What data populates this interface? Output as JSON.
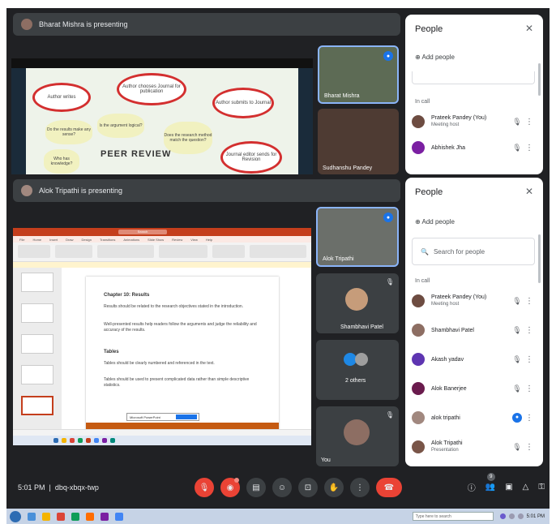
{
  "top_window": {
    "presenting_text": "Bharat Mishra is presenting",
    "slide": {
      "title": "PEER REVIEW",
      "ellipses": [
        "Author writes",
        "Author chooses Journal for publication",
        "Author submits to Journal",
        "Journal editor sends for Revision"
      ],
      "clouds": [
        "Do the results make any sense?",
        "Is the argument logical?",
        "Does the research method match the question?",
        "Who has knowledge?"
      ]
    },
    "tiles": [
      {
        "name": "Bharat Mishra"
      },
      {
        "name": "Sudhanshu Pandey"
      }
    ],
    "people_panel": {
      "title": "People",
      "close_icon": "close-icon",
      "add_people": "Add people",
      "in_call": "In call",
      "members": [
        {
          "name": "Prateek Pandey (You)",
          "sub": "Meeting host",
          "avatar_color": "#6d4c41"
        },
        {
          "name": "Abhishek Jha",
          "sub": "",
          "avatar_color": "#7b1fa2"
        }
      ]
    }
  },
  "bottom_window": {
    "presenting_text": "Alok Tripathi is presenting",
    "tiles": [
      {
        "name": "Alok Tripathi"
      },
      {
        "name": "Shambhavi Patel"
      },
      {
        "name": "2 others"
      },
      {
        "name": "You"
      }
    ],
    "ppt": {
      "search_placeholder": "Search",
      "ribbon_tabs": [
        "File",
        "Home",
        "Insert",
        "Draw",
        "Design",
        "Transitions",
        "Animations",
        "Slide Show",
        "Review",
        "View",
        "Help"
      ],
      "slide_heading_1": "Chapter 10: Results",
      "slide_bullets_1": [
        "Results should be related to the research objectives stated in the introduction.",
        "Well-presented results help readers follow the arguments and judge the reliability and accuracy of the results."
      ],
      "slide_heading_2": "Tables",
      "slide_bullets_2": [
        "Tables should be clearly numbered and referenced in the text.",
        "Tables should be used to present complicated data rather than simple descriptive statistics."
      ],
      "dialog_text": "Microsoft PowerPoint"
    },
    "people_panel": {
      "title": "People",
      "add_people": "Add people",
      "search_placeholder": "Search for people",
      "in_call": "In call",
      "members": [
        {
          "name": "Prateek Pandey (You)",
          "sub": "Meeting host",
          "avatar_color": "#6d4c41",
          "mic": "muted"
        },
        {
          "name": "Shambhavi Patel",
          "sub": "",
          "avatar_color": "#8d6e63",
          "mic": "muted"
        },
        {
          "name": "Akash yadav",
          "sub": "",
          "avatar_color": "#5e35b1",
          "mic": "muted"
        },
        {
          "name": "Alok Banerjee",
          "sub": "",
          "avatar_color": "#6a1b4d",
          "mic": "muted"
        },
        {
          "name": "alok tripathi",
          "sub": "",
          "avatar_color": "#a1887f",
          "mic": "active"
        },
        {
          "name": "Alok Tripathi",
          "sub": "Presentation",
          "avatar_color": "#795548",
          "mic": "muted"
        }
      ]
    },
    "meeting_info": {
      "time": "5:01 PM",
      "code": "dbq-xbqx-twp"
    },
    "right_controls": {
      "people_count": "9"
    }
  },
  "windows_taskbar": {
    "search_placeholder": "Type here to search",
    "clock": "5:01 PM"
  }
}
